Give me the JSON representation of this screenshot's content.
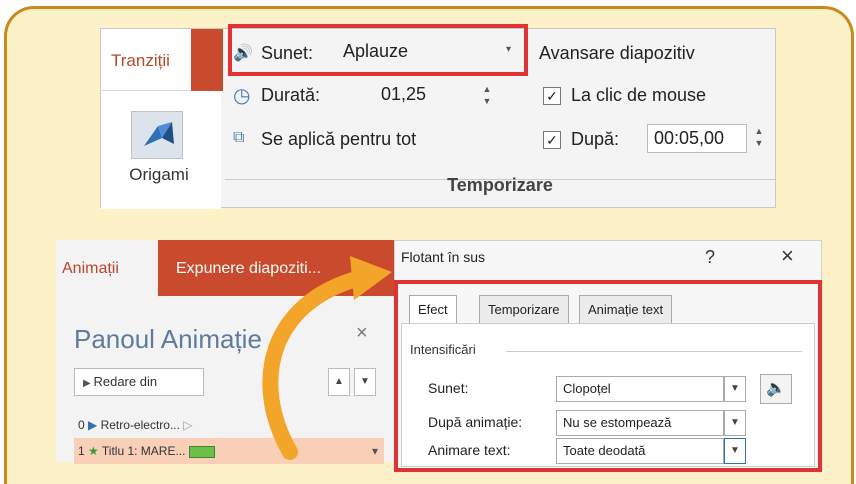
{
  "top_ribbon": {
    "tab_label": "Tranziții",
    "origami_label": "Origami",
    "sound_label": "Sunet:",
    "sound_value": "Aplauze",
    "duration_label": "Durată:",
    "duration_value": "01,25",
    "apply_all_label": "Se aplică pentru tot",
    "advance_title": "Avansare diapozitiv",
    "on_click_label": "La clic de mouse",
    "after_label": "După:",
    "after_value": "00:05,00",
    "group_label": "Temporizare"
  },
  "anim_pane": {
    "tab_active": "Animații",
    "tab_slideshow": "Expunere diapoziti...",
    "title": "Panoul Animație",
    "play_from": "Redare din",
    "rows": [
      {
        "num": "0",
        "label": "Retro-electro..."
      },
      {
        "num": "1",
        "label": "Titlu 1: MARE..."
      }
    ]
  },
  "dialog": {
    "title": "Flotant în sus",
    "help": "?",
    "close": "×",
    "tabs": [
      "Efect",
      "Temporizare",
      "Animație text"
    ],
    "section": "Intensificări",
    "sound_label": "Sunet:",
    "sound_value": "Clopoțel",
    "after_anim_label": "După animație:",
    "after_anim_value": "Nu se estompează",
    "animate_text_label": "Animare text:",
    "animate_text_value": "Toate deodată"
  },
  "colors": {
    "frame_border": "#c98a1a",
    "frame_bg": "#fdf1c8",
    "highlight": "#e03434",
    "accent_tab": "#c94a2c"
  }
}
